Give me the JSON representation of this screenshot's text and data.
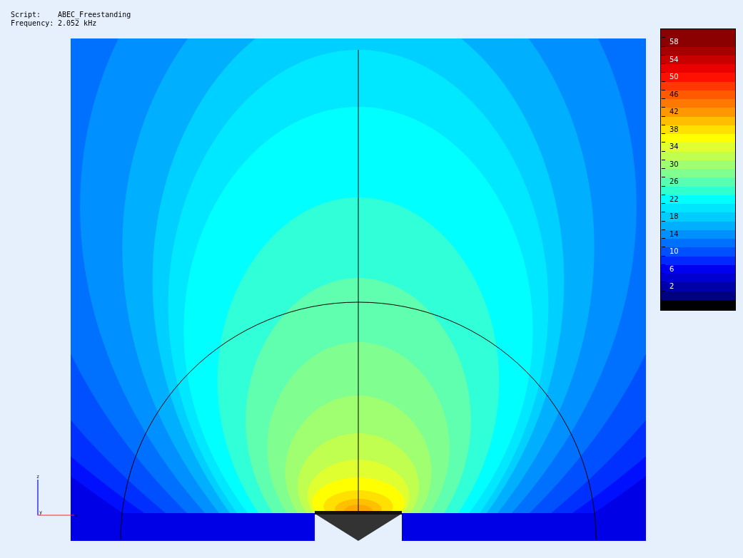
{
  "info": [
    {
      "label": "Script:",
      "value": "ABEC_Freestanding"
    },
    {
      "label": "Frequency:",
      "value": "2.052 kHz"
    }
  ],
  "axes": {
    "labels": [
      "z",
      "y",
      "x"
    ]
  },
  "colorbar": {
    "bands": [
      {
        "color": "#8b0000"
      },
      {
        "color": "#8b0000",
        "label": "58"
      },
      {
        "color": "#a80000"
      },
      {
        "color": "#c80000",
        "label": "54"
      },
      {
        "color": "#ea0000"
      },
      {
        "color": "#ff1000",
        "label": "50"
      },
      {
        "color": "#ff3800"
      },
      {
        "color": "#ff5a00",
        "label": "46"
      },
      {
        "color": "#ff7800"
      },
      {
        "color": "#ff9800",
        "label": "42"
      },
      {
        "color": "#ffbe00"
      },
      {
        "color": "#ffe000",
        "label": "38"
      },
      {
        "color": "#ffff00"
      },
      {
        "color": "#e0ff30",
        "label": "34"
      },
      {
        "color": "#c0ff50"
      },
      {
        "color": "#a0ff70",
        "label": "30"
      },
      {
        "color": "#80ff90"
      },
      {
        "color": "#58ffb0",
        "label": "26"
      },
      {
        "color": "#30ffd0"
      },
      {
        "color": "#00ffff",
        "label": "22"
      },
      {
        "color": "#00e6ff"
      },
      {
        "color": "#00ccff",
        "label": "18"
      },
      {
        "color": "#00b0ff"
      },
      {
        "color": "#0090ff",
        "label": "14"
      },
      {
        "color": "#0070ff"
      },
      {
        "color": "#0050ff",
        "label": "10"
      },
      {
        "color": "#0028ff"
      },
      {
        "color": "#0000f0",
        "label": "6"
      },
      {
        "color": "#0000d0"
      },
      {
        "color": "#0000a8",
        "label": "2"
      },
      {
        "color": "#000080"
      },
      {
        "color": "#000000"
      }
    ]
  }
}
